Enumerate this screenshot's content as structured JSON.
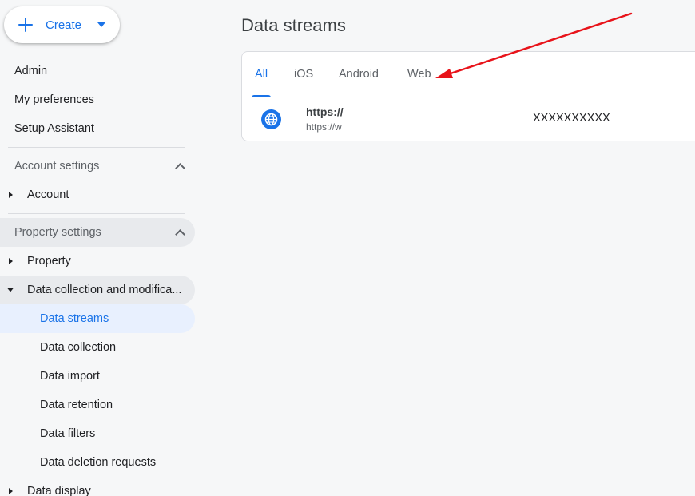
{
  "sidebar": {
    "create": {
      "label": "Create",
      "icon": "plus-icon",
      "dropdown_icon": "caret-down-icon"
    },
    "top_links": [
      "Admin",
      "My preferences",
      "Setup Assistant"
    ],
    "account_settings": {
      "label": "Account settings",
      "items": [
        "Account"
      ]
    },
    "property_settings": {
      "label": "Property settings",
      "items": {
        "property": "Property",
        "data_collection_group": "Data collection and modifica...",
        "children": [
          "Data streams",
          "Data collection",
          "Data import",
          "Data retention",
          "Data filters",
          "Data deletion requests"
        ],
        "data_display": "Data display"
      }
    }
  },
  "main": {
    "title": "Data streams",
    "tabs": [
      "All",
      "iOS",
      "Android",
      "Web"
    ],
    "active_tab": "All",
    "streams": [
      {
        "name": "https://",
        "url": "https://w",
        "id": "XXXXXXXXXX",
        "icon": "globe-icon"
      }
    ]
  },
  "colors": {
    "accent": "#1a73e8",
    "selected_bg": "#e8f0fe",
    "annotation_arrow": "#e8131a",
    "background": "#f6f7f8"
  }
}
